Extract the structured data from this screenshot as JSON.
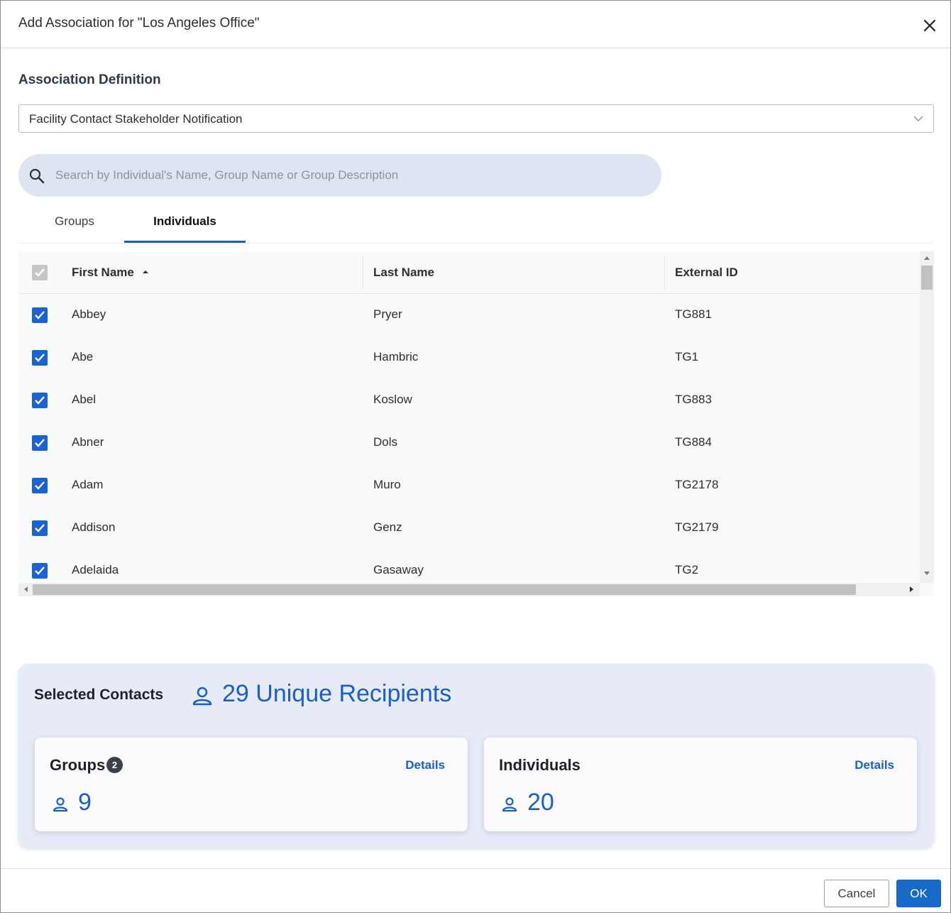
{
  "dialog": {
    "title": "Add Association for \"Los Angeles Office\"",
    "close_label": "X"
  },
  "association": {
    "label": "Association Definition",
    "selected": "Facility Contact Stakeholder Notification"
  },
  "search": {
    "placeholder": "Search by Individual's Name, Group Name or Group Description",
    "value": ""
  },
  "tabs": [
    {
      "label": "Groups",
      "active": false
    },
    {
      "label": "Individuals",
      "active": true
    }
  ],
  "grid": {
    "columns": [
      "First Name",
      "Last Name",
      "External ID"
    ],
    "sort": {
      "column": "First Name",
      "direction": "ascending"
    },
    "rows": [
      {
        "first": "Abbey",
        "last": "Pryer",
        "external_id": "TG881",
        "checked": true
      },
      {
        "first": "Abe",
        "last": "Hambric",
        "external_id": "TG1",
        "checked": true
      },
      {
        "first": "Abel",
        "last": "Koslow",
        "external_id": "TG883",
        "checked": true
      },
      {
        "first": "Abner",
        "last": "Dols",
        "external_id": "TG884",
        "checked": true
      },
      {
        "first": "Adam",
        "last": "Muro",
        "external_id": "TG2178",
        "checked": true
      },
      {
        "first": "Addison",
        "last": "Genz",
        "external_id": "TG2179",
        "checked": true
      },
      {
        "first": "Adelaida",
        "last": "Gasaway",
        "external_id": "TG2",
        "checked": true
      }
    ]
  },
  "summary": {
    "title": "Selected Contacts",
    "recipients": "29 Unique Recipients",
    "groups": {
      "title": "Groups",
      "badge": "2",
      "details": "Details",
      "count": "9"
    },
    "individuals": {
      "title": "Individuals",
      "details": "Details",
      "count": "20"
    }
  },
  "footer": {
    "cancel": "Cancel",
    "ok": "OK"
  },
  "colors": {
    "accent": "#1a62d8",
    "link": "#1a5fc8",
    "search_bg": "#dde4f2",
    "summary_bg": "#e6ebf7"
  }
}
